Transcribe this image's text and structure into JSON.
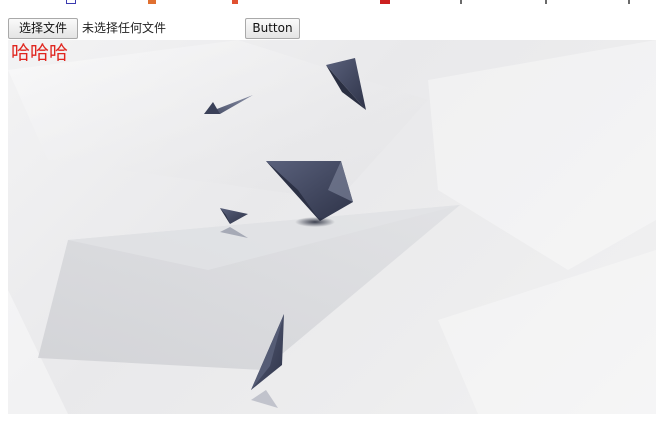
{
  "top_strip_colors": [
    "#3b3bb0",
    "#e07030",
    "#e05030",
    "#cc2020",
    "#6a6a6a",
    "#6a6a6a",
    "#6a6a6a"
  ],
  "file_picker": {
    "button_label": "选择文件",
    "status_text": "未选择任何文件"
  },
  "button": {
    "label": "Button"
  },
  "overlay_text": "哈哈哈",
  "colors": {
    "overlay_text": "#e0261f",
    "shard_dark": "#3f465f"
  }
}
